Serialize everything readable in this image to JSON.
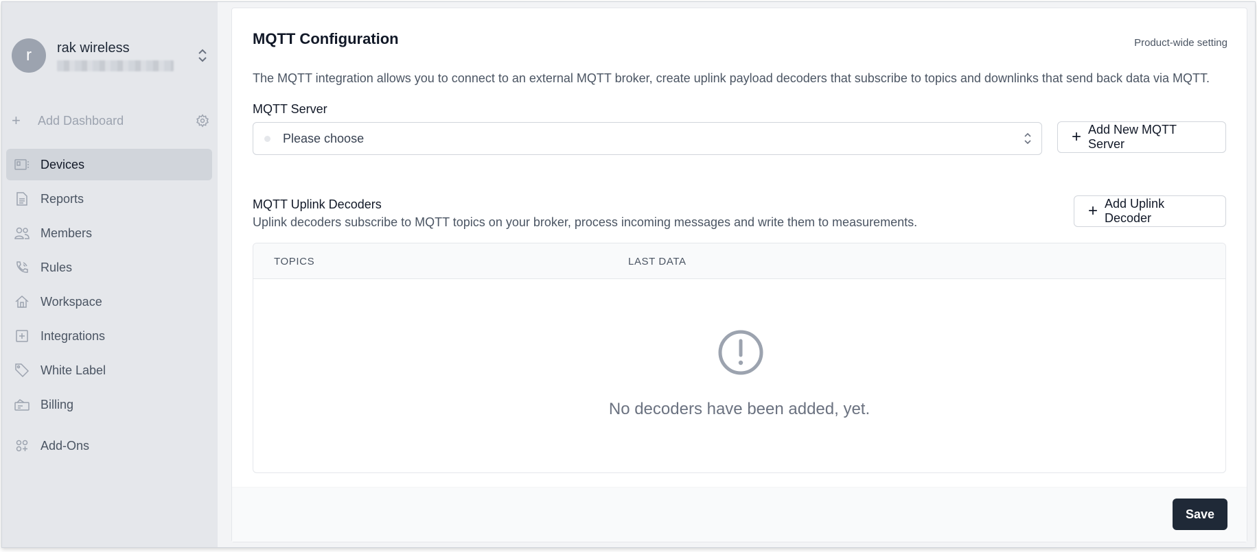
{
  "account": {
    "initial": "r",
    "name": "rak wireless"
  },
  "sidebar": {
    "add_dashboard": "Add Dashboard",
    "items": [
      {
        "label": "Devices",
        "icon": "devices-icon",
        "active": true
      },
      {
        "label": "Reports",
        "icon": "document-icon"
      },
      {
        "label": "Members",
        "icon": "users-icon"
      },
      {
        "label": "Rules",
        "icon": "phone-signal-icon"
      },
      {
        "label": "Workspace",
        "icon": "home-icon"
      },
      {
        "label": "Integrations",
        "icon": "plus-square-icon"
      },
      {
        "label": "White Label",
        "icon": "tag-icon"
      },
      {
        "label": "Billing",
        "icon": "billing-icon"
      },
      {
        "label": "Add-Ons",
        "icon": "addons-icon"
      }
    ]
  },
  "main": {
    "title": "MQTT Configuration",
    "scope": "Product-wide setting",
    "description": "The MQTT integration allows you to connect to an external MQTT broker, create uplink payload decoders that subscribe to topics and downlinks that send back data via MQTT.",
    "server_label": "MQTT Server",
    "server_select_value": "Please choose",
    "add_server_label": "Add New MQTT Server",
    "decoders_title": "MQTT Uplink Decoders",
    "decoders_description": "Uplink decoders subscribe to MQTT topics on your broker, process incoming messages and write them to measurements.",
    "add_decoder_label": "Add Uplink Decoder",
    "table": {
      "columns": [
        "TOPICS",
        "LAST DATA"
      ],
      "empty_message": "No decoders have been added, yet."
    },
    "save_label": "Save"
  },
  "colors": {
    "sidebar_bg": "#e5e7eb",
    "active_item_bg": "#d1d5db",
    "primary_button": "#1f2937"
  }
}
